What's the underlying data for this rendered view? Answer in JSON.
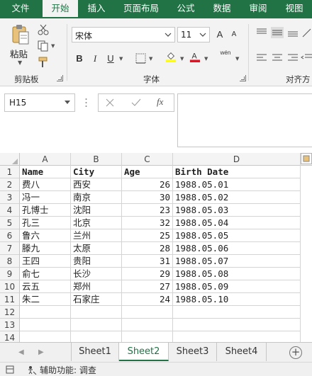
{
  "ribbon_tabs": [
    {
      "label": "文件"
    },
    {
      "label": "开始"
    },
    {
      "label": "插入"
    },
    {
      "label": "页面布局"
    },
    {
      "label": "公式"
    },
    {
      "label": "数据"
    },
    {
      "label": "审阅"
    },
    {
      "label": "视图"
    }
  ],
  "active_tab": "开始",
  "clipboard": {
    "paste_label": "粘贴",
    "group_label": "剪贴板"
  },
  "font": {
    "name": "宋体",
    "size": "11",
    "group_label": "字体",
    "bold": "B",
    "italic": "I",
    "underline": "U",
    "grow": "A",
    "shrink": "A",
    "phonetic": "wén"
  },
  "alignment": {
    "group_label": "对齐方"
  },
  "name_box": "H15",
  "formula_bar": {
    "fx": "fx",
    "value": ""
  },
  "columns": [
    "A",
    "B",
    "C",
    "D"
  ],
  "rows": [
    {
      "n": "1",
      "a": "Name",
      "b": "City",
      "c": "Age",
      "d": "Birth Date"
    },
    {
      "n": "2",
      "a": "费八",
      "b": "西安",
      "c": "26",
      "d": "1988.05.01"
    },
    {
      "n": "3",
      "a": "冯一",
      "b": "南京",
      "c": "30",
      "d": "1988.05.02"
    },
    {
      "n": "4",
      "a": "孔博士",
      "b": "沈阳",
      "c": "23",
      "d": "1988.05.03"
    },
    {
      "n": "5",
      "a": "孔三",
      "b": "北京",
      "c": "32",
      "d": "1988.05.04"
    },
    {
      "n": "6",
      "a": "鲁六",
      "b": "兰州",
      "c": "25",
      "d": "1988.05.05"
    },
    {
      "n": "7",
      "a": "滕九",
      "b": "太原",
      "c": "28",
      "d": "1988.05.06"
    },
    {
      "n": "8",
      "a": "王四",
      "b": "贵阳",
      "c": "31",
      "d": "1988.05.07"
    },
    {
      "n": "9",
      "a": "俞七",
      "b": "长沙",
      "c": "29",
      "d": "1988.05.08"
    },
    {
      "n": "10",
      "a": "云五",
      "b": "郑州",
      "c": "27",
      "d": "1988.05.09"
    },
    {
      "n": "11",
      "a": "朱二",
      "b": "石家庄",
      "c": "24",
      "d": "1988.05.10"
    },
    {
      "n": "12",
      "a": "",
      "b": "",
      "c": "",
      "d": ""
    },
    {
      "n": "13",
      "a": "",
      "b": "",
      "c": "",
      "d": ""
    },
    {
      "n": "14",
      "a": "",
      "b": "",
      "c": "",
      "d": ""
    }
  ],
  "sheets": [
    {
      "label": "Sheet1"
    },
    {
      "label": "Sheet2"
    },
    {
      "label": "Sheet3"
    },
    {
      "label": "Sheet4"
    }
  ],
  "active_sheet": "Sheet2",
  "add_sheet": "+",
  "status": {
    "accessibility": "辅助功能: 调查"
  },
  "colors": {
    "brand": "#217346",
    "ribbon_bg": "#f3f3f3",
    "font_color_bar": "#e81123",
    "highlight_bar": "#ffff00"
  }
}
